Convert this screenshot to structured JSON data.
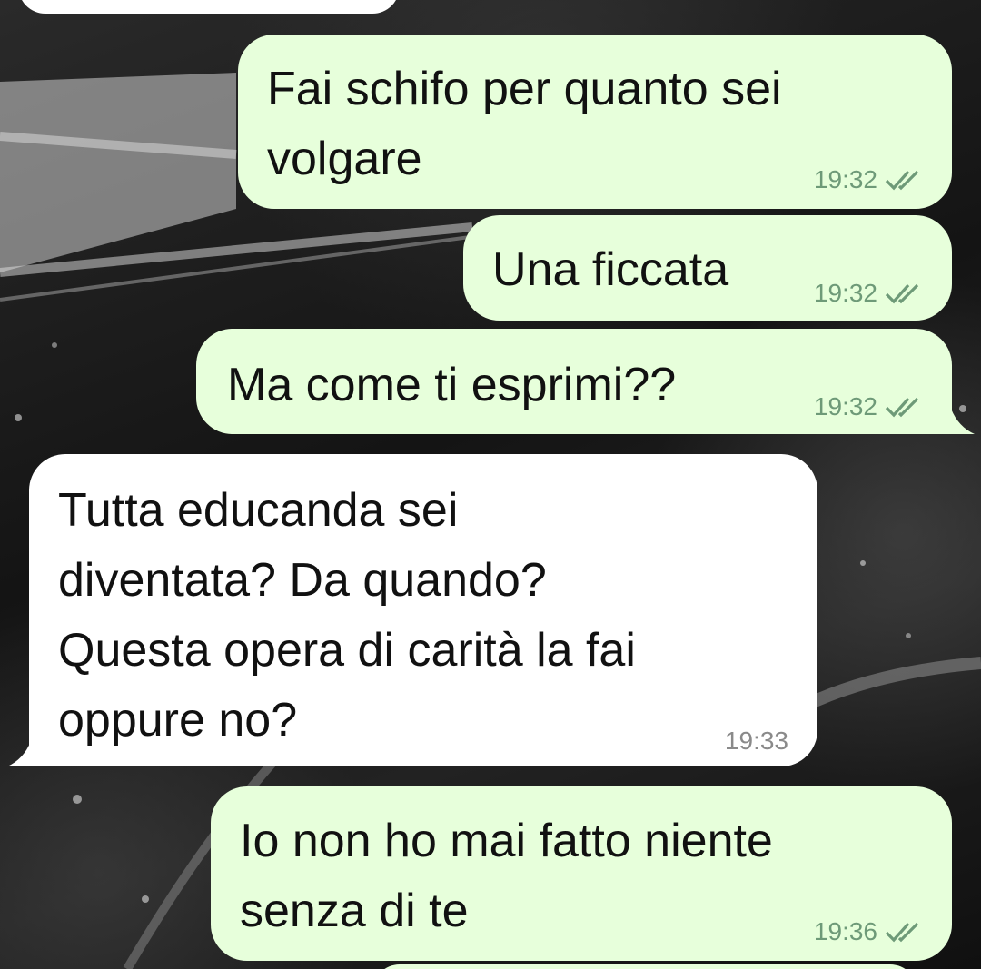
{
  "chat": {
    "messages": [
      {
        "direction": "outgoing",
        "text": "Fai schifo per quanto sei\nvolgare",
        "time": "19:32",
        "status": "read-double-check-icon"
      },
      {
        "direction": "outgoing",
        "text": "Una ficcata",
        "time": "19:32",
        "status": "read-double-check-icon"
      },
      {
        "direction": "outgoing",
        "text": "Ma come ti esprimi??",
        "time": "19:32",
        "status": "read-double-check-icon"
      },
      {
        "direction": "incoming",
        "text": "Tutta educanda sei\ndiventata? Da quando?\nQuesta opera di carità la fai\noppure no?",
        "time": "19:33"
      },
      {
        "direction": "outgoing",
        "text": "Io non ho mai fatto niente\nsenza di te",
        "time": "19:36",
        "status": "read-double-check-icon"
      }
    ]
  },
  "colors": {
    "outgoing_bubble": "#e7ffdb",
    "incoming_bubble": "#ffffff",
    "tick_color": "#6e9a78",
    "wallpaper": "#1b1b1b"
  }
}
